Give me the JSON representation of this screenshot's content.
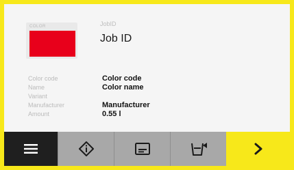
{
  "swatch": {
    "label": "COLOR",
    "color": "#e8001b"
  },
  "job": {
    "caption": "JobID",
    "value": "Job ID"
  },
  "info": [
    {
      "label": "Color code",
      "value": "Color code"
    },
    {
      "label": "Name",
      "value": "Color name"
    },
    {
      "label": "Variant",
      "value": ""
    },
    {
      "label": "Manufacturer",
      "value": "Manufacturer"
    },
    {
      "label": "Amount",
      "value": "0.55 l"
    }
  ],
  "toolbar": {
    "items": [
      {
        "icon": "menu-icon"
      },
      {
        "icon": "info-diamond-icon"
      },
      {
        "icon": "card-icon"
      },
      {
        "icon": "can-eject-icon"
      },
      {
        "icon": "chevron-right-icon"
      }
    ]
  },
  "colors": {
    "frame": "#f7e81a",
    "accent_red": "#e8001b",
    "toolbar_dark": "#1f1f1f",
    "toolbar_gray": "#a8a8a8"
  }
}
